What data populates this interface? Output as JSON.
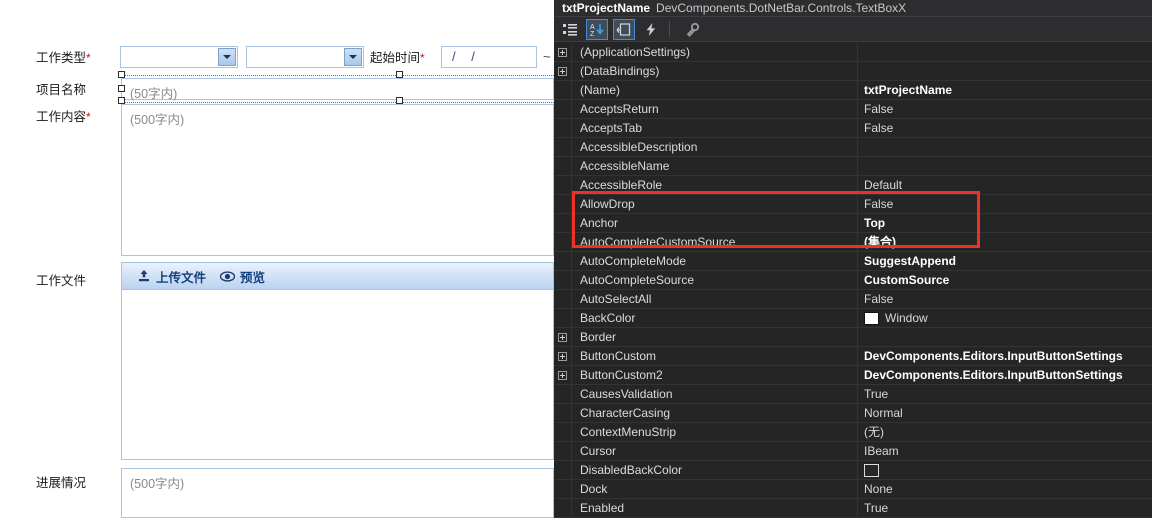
{
  "designer": {
    "fields": [
      {
        "label": "工作类型",
        "required": true
      },
      {
        "label": "起始时间",
        "required": true
      },
      {
        "label": "项目名称",
        "required": false
      },
      {
        "label": "工作内容",
        "required": true
      },
      {
        "label": "工作文件",
        "required": false
      },
      {
        "label": "进展情况",
        "required": false
      }
    ],
    "work_type_label": "工作类型",
    "start_time_label": "起始时间",
    "project_name_label": "项目名称",
    "work_content_label": "工作内容",
    "work_file_label": "工作文件",
    "progress_label": "进展情况",
    "required_mark": "*",
    "combo1_value": "",
    "combo2_value": "",
    "date_value": "/    /",
    "range_separator": "~",
    "project_name_placeholder": "(50字内)",
    "work_content_placeholder": "(500字内)",
    "progress_placeholder": "(500字内)",
    "upload_button_label": "上传文件",
    "preview_button_label": "预览"
  },
  "properties_pane": {
    "header": {
      "object_name": "txtProjectName",
      "object_type": "DevComponents.DotNetBar.Controls.TextBoxX"
    },
    "toolbar": [
      {
        "name": "categorized-icon",
        "active": false
      },
      {
        "name": "alphabetical-sort-icon",
        "active": true
      },
      {
        "name": "properties-icon",
        "active": true
      },
      {
        "name": "events-lightning-icon",
        "active": false
      },
      {
        "name": "property-pages-icon",
        "active": false
      }
    ],
    "highlight_color": "#ee3124",
    "rows": [
      {
        "name": "(ApplicationSettings)",
        "value": "",
        "expandable": true,
        "bold": false
      },
      {
        "name": "(DataBindings)",
        "value": "",
        "expandable": true,
        "bold": false
      },
      {
        "name": "(Name)",
        "value": "txtProjectName",
        "expandable": false,
        "bold": true
      },
      {
        "name": "AcceptsReturn",
        "value": "False",
        "expandable": false,
        "bold": false
      },
      {
        "name": "AcceptsTab",
        "value": "False",
        "expandable": false,
        "bold": false
      },
      {
        "name": "AccessibleDescription",
        "value": "",
        "expandable": false,
        "bold": false
      },
      {
        "name": "AccessibleName",
        "value": "",
        "expandable": false,
        "bold": false
      },
      {
        "name": "AccessibleRole",
        "value": "Default",
        "expandable": false,
        "bold": false
      },
      {
        "name": "AllowDrop",
        "value": "False",
        "expandable": false,
        "bold": false
      },
      {
        "name": "Anchor",
        "value": "Top",
        "expandable": false,
        "bold": true
      },
      {
        "name": "AutoCompleteCustomSource",
        "value": "(集合)",
        "expandable": false,
        "bold": true,
        "highlighted": true
      },
      {
        "name": "AutoCompleteMode",
        "value": "SuggestAppend",
        "expandable": false,
        "bold": true,
        "highlighted": true
      },
      {
        "name": "AutoCompleteSource",
        "value": "CustomSource",
        "expandable": false,
        "bold": true,
        "highlighted": true
      },
      {
        "name": "AutoSelectAll",
        "value": "False",
        "expandable": false,
        "bold": false
      },
      {
        "name": "BackColor",
        "value": "Window",
        "expandable": false,
        "bold": false,
        "swatch": "#ffffff"
      },
      {
        "name": "Border",
        "value": "",
        "expandable": true,
        "bold": false
      },
      {
        "name": "ButtonCustom",
        "value": "DevComponents.Editors.InputButtonSettings",
        "expandable": true,
        "bold": true
      },
      {
        "name": "ButtonCustom2",
        "value": "DevComponents.Editors.InputButtonSettings",
        "expandable": true,
        "bold": true
      },
      {
        "name": "CausesValidation",
        "value": "True",
        "expandable": false,
        "bold": false
      },
      {
        "name": "CharacterCasing",
        "value": "Normal",
        "expandable": false,
        "bold": false
      },
      {
        "name": "ContextMenuStrip",
        "value": "(无)",
        "expandable": false,
        "bold": false
      },
      {
        "name": "Cursor",
        "value": "IBeam",
        "expandable": false,
        "bold": false
      },
      {
        "name": "DisabledBackColor",
        "value": "",
        "expandable": false,
        "bold": false,
        "swatch": "outline"
      },
      {
        "name": "Dock",
        "value": "None",
        "expandable": false,
        "bold": false
      },
      {
        "name": "Enabled",
        "value": "True",
        "expandable": false,
        "bold": false
      }
    ]
  }
}
